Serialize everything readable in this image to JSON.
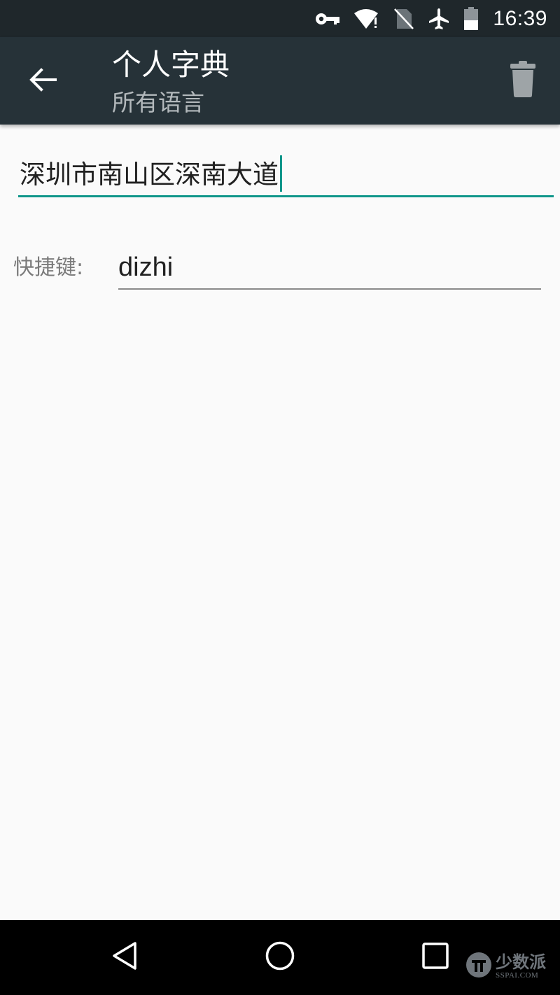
{
  "status_bar": {
    "time": "16:39",
    "icons": [
      "vpn-key-icon",
      "wifi-alert-icon",
      "no-sim-icon",
      "airplane-icon",
      "battery-icon"
    ]
  },
  "toolbar": {
    "title": "个人字典",
    "subtitle": "所有语言",
    "back_icon": "arrow-left-icon",
    "delete_icon": "trash-icon"
  },
  "form": {
    "word_value": "深圳市南山区深南大道",
    "shortcut_label": "快捷键:",
    "shortcut_value": "dizhi"
  },
  "nav_bar": {
    "icons": [
      "triangle-back-icon",
      "circle-home-icon",
      "square-recents-icon"
    ]
  },
  "watermark": {
    "main": "少数派",
    "sub": "SSPAI.COM"
  },
  "colors": {
    "status_bar": "#1f272b",
    "toolbar": "#263238",
    "accent": "#0f968a",
    "background": "#fafafa"
  }
}
